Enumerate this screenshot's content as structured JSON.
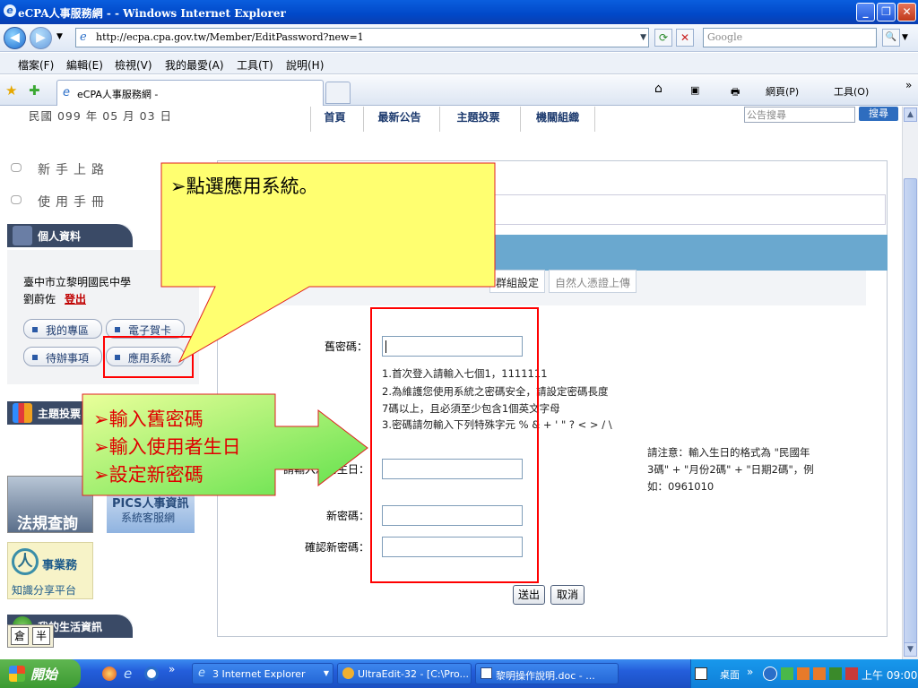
{
  "window": {
    "title": "eCPA人事服務網 - - Windows Internet Explorer",
    "minimize": "_",
    "restore": "❐",
    "close": "✕"
  },
  "addressbar": {
    "back": "◀",
    "forward": "▶",
    "url": "http://ecpa.cpa.gov.tw/Member/EditPassword?new=1",
    "search_placeholder": "Google",
    "search_btn": "🔍",
    "refresh": "⟳",
    "stop": "✕"
  },
  "menu": [
    "檔案(F)",
    "編輯(E)",
    "檢視(V)",
    "我的最愛(A)",
    "工具(T)",
    "說明(H)"
  ],
  "tabs": {
    "active": "eCPA人事服務網 -",
    "tools": [
      "網頁(P)",
      "工具(O)"
    ]
  },
  "page": {
    "date": "民國 099 年 05 月 03 日",
    "topnav": [
      "首頁",
      "最新公告",
      "主題投票",
      "機關組織"
    ],
    "search_placeholder": "公告搜尋",
    "search_btn": "搜尋",
    "sidemenu": [
      "新手上路",
      "使用手冊"
    ],
    "personal_header": "個人資料",
    "org": "臺中市立黎明國民中學",
    "user": "劉蔚佐",
    "logout": "登出",
    "side_buttons": [
      "我的專區",
      "電子賀卡",
      "待辦事項",
      "應用系統"
    ],
    "vote_header": "主題投票",
    "banner_laws": "法規查詢",
    "banner_pics_1": "PICS人事資訊",
    "banner_pics_2": "系統客服網",
    "banner_knowledge_1": "人",
    "banner_knowledge_2": "事業務",
    "banner_knowledge_3": "知識分享平台",
    "life_header": "我的生活資訊",
    "tabs": [
      "群組設定",
      "自然人憑證上傳"
    ],
    "form": {
      "old_pwd_label": "舊密碼：",
      "note1": "1.首次登入請輸入七個1，1111111",
      "note2a": "2.為維護您使用系統之密碼安全，請設定密碼長度",
      "note2b": "7碼以上，且必須至少包含1個英文字母",
      "note3": "3.密碼請勿輸入下列特殊字元 % & + ' \" ? < > / \\",
      "birthday_label": "請輸入您的生日：",
      "birthday_note1": "請注意：輸入生日的格式為 \"民國年",
      "birthday_note2": "3碼\" + \"月份2碼\" + \"日期2碼\"，例",
      "birthday_note3": "如：0961010",
      "new_pwd_label": "新密碼：",
      "confirm_pwd_label": "確認新密碼：",
      "submit": "送出",
      "cancel": "取消"
    },
    "ime": [
      "倉",
      "半"
    ]
  },
  "callouts": {
    "top": "➢點選應用系統。",
    "bottom": [
      "➢輸入舊密碼",
      "➢輸入使用者生日",
      "➢設定新密碼"
    ]
  },
  "taskbar": {
    "start": "開始",
    "tasks": [
      "3 Internet Explorer",
      "UltraEdit-32 - [C:\\Pro...",
      "黎明操作說明.doc - ..."
    ],
    "tray_desktop": "桌面",
    "clock": "上午 09:00"
  },
  "colors": {
    "callout_top_fill": "#ffff66",
    "callout_bottom_fill": "#66ee44",
    "highlight_red": "#ff0000",
    "callout_text_red": "#e00000"
  }
}
